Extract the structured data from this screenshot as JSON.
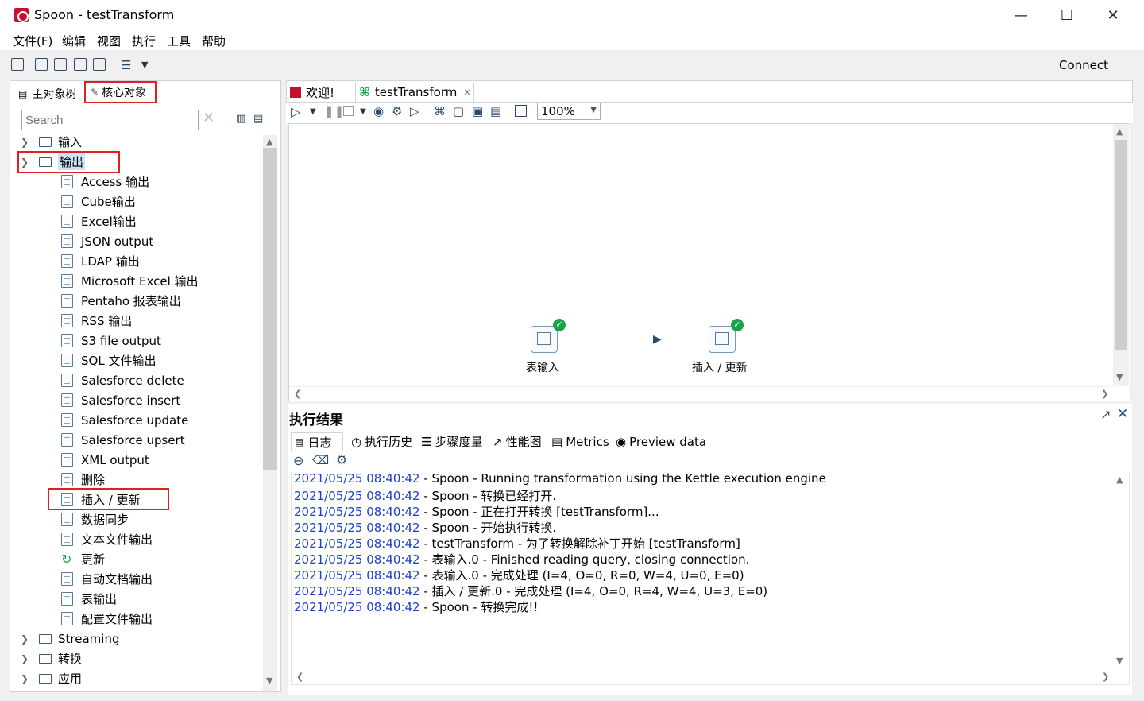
{
  "window": {
    "title": "Spoon - testTransform"
  },
  "menu": [
    "文件(F)",
    "编辑",
    "视图",
    "执行",
    "工具",
    "帮助"
  ],
  "toolbar": {
    "connect_label": "Connect"
  },
  "left_panel": {
    "tabs": [
      "主对象树",
      "核心对象"
    ],
    "search_placeholder": "Search",
    "tree": {
      "input_folder": "输入",
      "output_folder": "输出",
      "output_items": [
        "Access 输出",
        "Cube输出",
        "Excel输出",
        "JSON output",
        "LDAP 输出",
        "Microsoft Excel 输出",
        "Pentaho 报表输出",
        "RSS 输出",
        "S3 file output",
        "SQL 文件输出",
        "Salesforce delete",
        "Salesforce insert",
        "Salesforce update",
        "Salesforce upsert",
        "XML output",
        "删除",
        "插入 / 更新",
        "数据同步",
        "文本文件输出",
        "更新",
        "自动文档输出",
        "表输出",
        "配置文件输出"
      ],
      "other_folders": [
        "Streaming",
        "转换",
        "应用"
      ]
    }
  },
  "editor": {
    "tabs": [
      "欢迎!",
      "testTransform"
    ],
    "zoom": "100%",
    "nodes": [
      "表输入",
      "插入 / 更新"
    ]
  },
  "results": {
    "title": "执行结果",
    "tabs": [
      "日志",
      "执行历史",
      "步骤度量",
      "性能图",
      "Metrics",
      "Preview data"
    ],
    "log": [
      {
        "ts": "2021/05/25 08:40:42",
        "msg": " - Spoon - Running transformation using the Kettle execution engine"
      },
      {
        "ts": "2021/05/25 08:40:42",
        "msg": " - Spoon - 转换已经打开."
      },
      {
        "ts": "2021/05/25 08:40:42",
        "msg": " - Spoon - 正在打开转换 [testTransform]..."
      },
      {
        "ts": "2021/05/25 08:40:42",
        "msg": " - Spoon - 开始执行转换."
      },
      {
        "ts": "2021/05/25 08:40:42",
        "msg": " - testTransform - 为了转换解除补丁开始  [testTransform]"
      },
      {
        "ts": "2021/05/25 08:40:42",
        "msg": " - 表输入.0 - Finished reading query, closing connection."
      },
      {
        "ts": "2021/05/25 08:40:42",
        "msg": " - 表输入.0 - 完成处理 (I=4, O=0, R=0, W=4, U=0, E=0)"
      },
      {
        "ts": "2021/05/25 08:40:42",
        "msg": " - 插入 / 更新.0 - 完成处理 (I=4, O=0, R=4, W=4, U=3, E=0)"
      },
      {
        "ts": "2021/05/25 08:40:42",
        "msg": " - Spoon - 转换完成!!"
      }
    ]
  },
  "colors": {
    "accent_red": "#e02020",
    "timestamp_blue": "#1a3fcf",
    "ok_green": "#1aa34a"
  }
}
